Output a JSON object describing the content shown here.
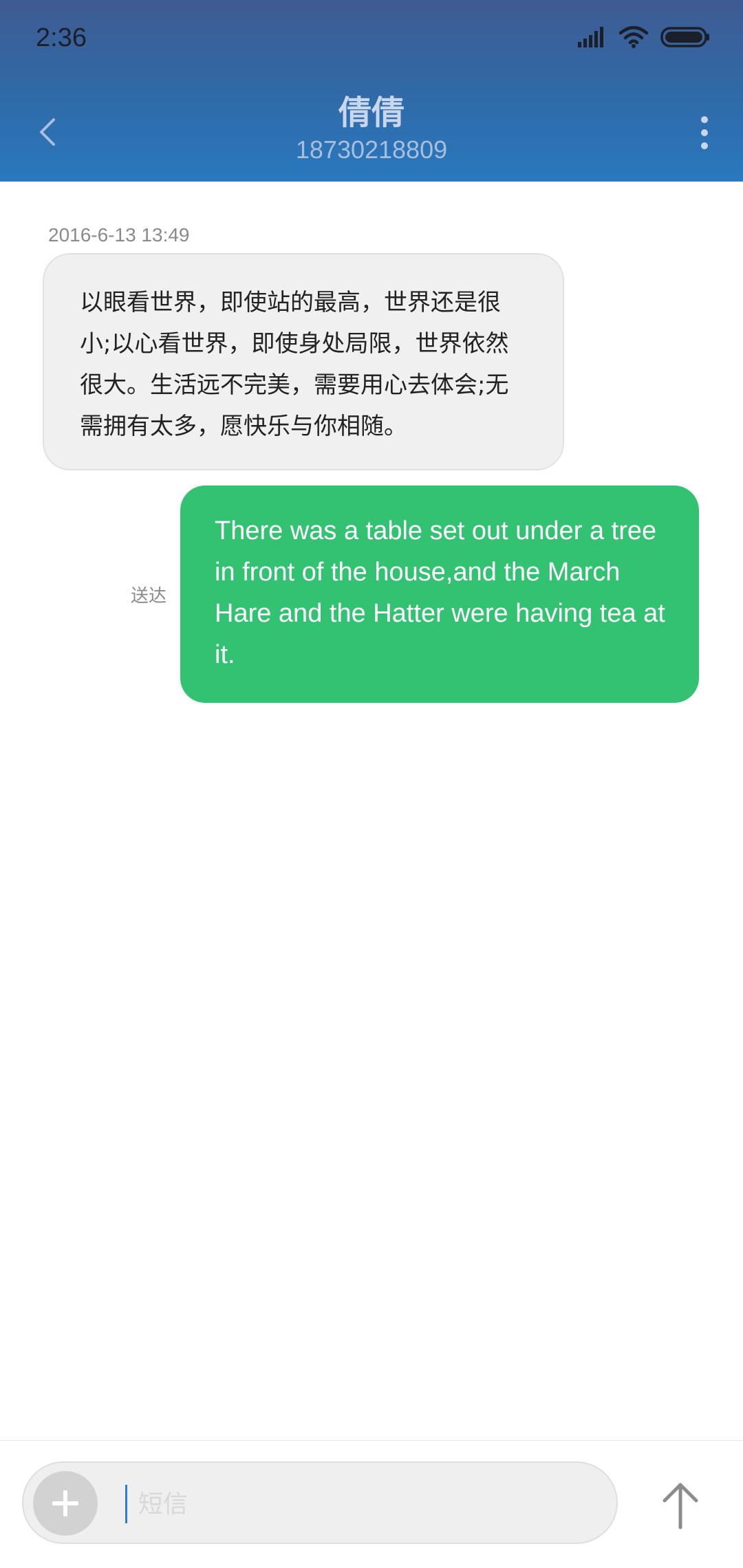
{
  "status_bar": {
    "time": "2:36"
  },
  "header": {
    "contact_name": "倩倩",
    "contact_number": "18730218809"
  },
  "messages": {
    "timestamp": "2016-6-13 13:49",
    "received_text": "以眼看世界，即使站的最高，世界还是很小;以心看世界，即使身处局限，世界依然很大。生活远不完美，需要用心去体会;无需拥有太多，愿快乐与你相随。",
    "sent_text": "There was a table set out under a tree in front of the house,and the March Hare and the Hatter were having tea at it.",
    "sent_status": "送达"
  },
  "composer": {
    "placeholder": "短信"
  },
  "colors": {
    "header_top": "#3f5b92",
    "header_bottom": "#2a78bf",
    "sent_bubble": "#33c172",
    "received_bubble": "#f0f0f0"
  },
  "icons": [
    "signal-icon",
    "wifi-icon",
    "battery-icon",
    "back-icon",
    "more-icon",
    "add-icon",
    "send-arrow-icon"
  ]
}
